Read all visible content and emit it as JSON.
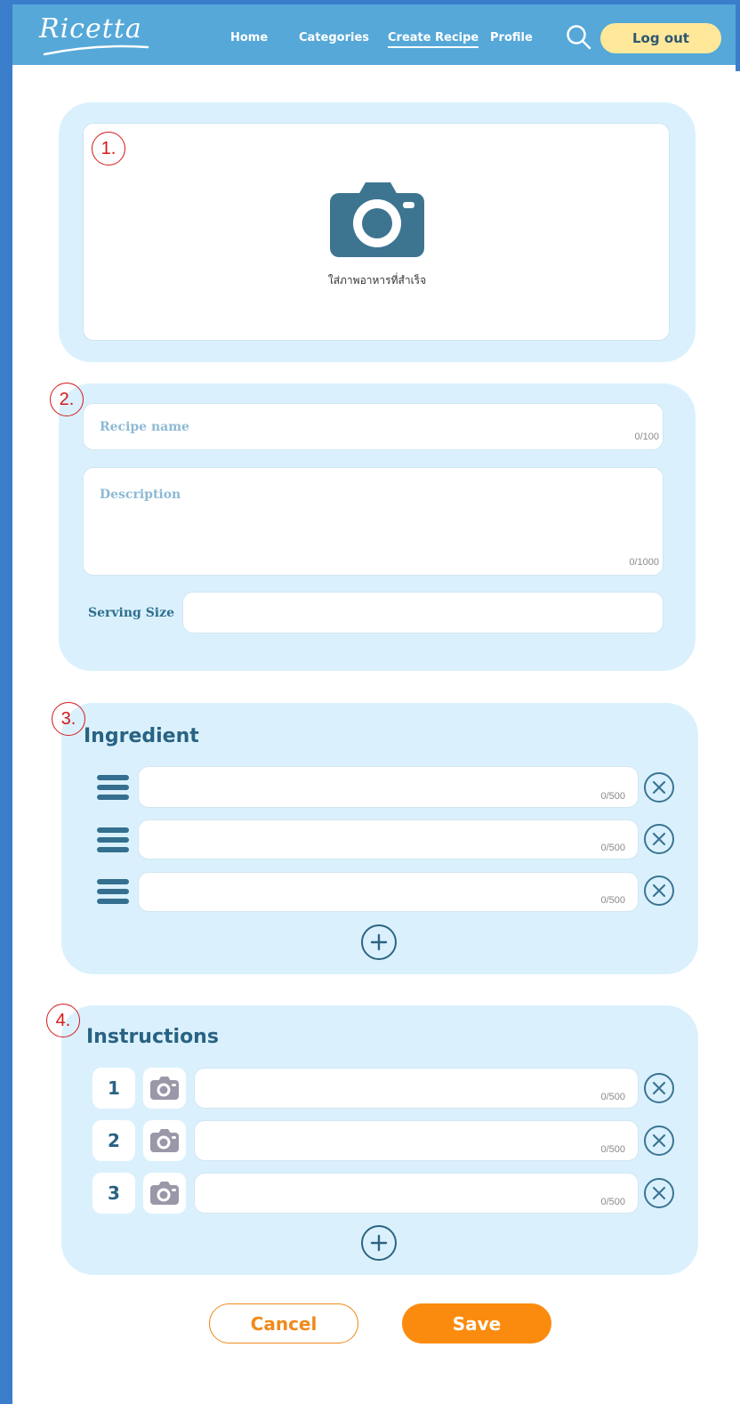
{
  "header": {
    "logo": "Ricetta",
    "nav": [
      {
        "label": "Home"
      },
      {
        "label": "Categories"
      },
      {
        "label": "Create Recipe"
      },
      {
        "label": "Profile"
      }
    ],
    "active_nav": "Create Recipe",
    "logout_label": "Log out"
  },
  "markers": [
    "1.",
    "2.",
    "3.",
    "4."
  ],
  "photo_section": {
    "caption": "ใส่ภาพอาหารที่สำเร็จ",
    "icon": "camera-icon"
  },
  "details_section": {
    "name_placeholder": "Recipe name",
    "name_counter": "0/100",
    "description_placeholder": "Description",
    "description_counter": "0/1000",
    "serving_label": "Serving Size",
    "serving_value": ""
  },
  "ingredient_section": {
    "title": "Ingredient",
    "rows": [
      {
        "value": "",
        "counter": "0/500"
      },
      {
        "value": "",
        "counter": "0/500"
      },
      {
        "value": "",
        "counter": "0/500"
      }
    ]
  },
  "instruction_section": {
    "title": "Instructions",
    "rows": [
      {
        "number": "1",
        "value": "",
        "counter": "0/500"
      },
      {
        "number": "2",
        "value": "",
        "counter": "0/500"
      },
      {
        "number": "3",
        "value": "",
        "counter": "0/500"
      }
    ]
  },
  "actions": {
    "cancel_label": "Cancel",
    "save_label": "Save"
  },
  "colors": {
    "header": "#55a8d8",
    "panel": "#daf1fd",
    "accent_orange": "#fb8b0e",
    "logout_yellow": "#ffe89a",
    "marker_red": "#d41a1a"
  }
}
